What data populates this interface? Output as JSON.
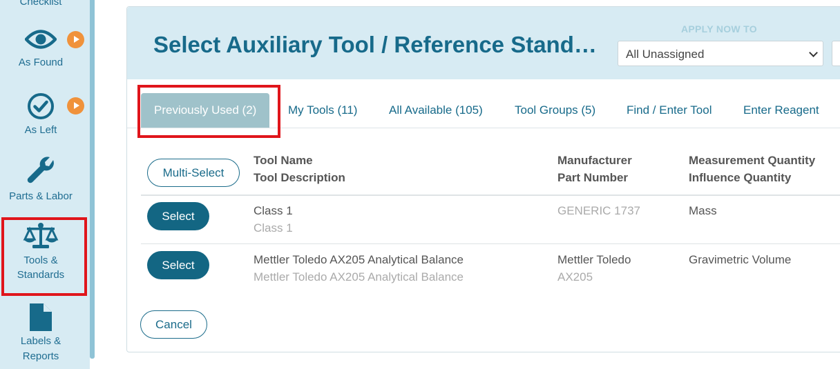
{
  "sidebar": {
    "items": [
      {
        "label": "Checklist",
        "icon": "checklist-icon"
      },
      {
        "label": "As Found",
        "icon": "eye-icon"
      },
      {
        "label": "As Left",
        "icon": "check-circle-icon"
      },
      {
        "label": "Parts & Labor",
        "icon": "wrench-icon"
      },
      {
        "label1": "Tools &",
        "label2": "Standards",
        "icon": "scale-icon"
      },
      {
        "label1": "Labels &",
        "label2": "Reports",
        "icon": "document-icon"
      }
    ]
  },
  "header": {
    "title": "Select Auxiliary Tool / Reference Stand…",
    "apply_label": "APPLY NOW TO",
    "apply_value": "All Unassigned"
  },
  "tabs": [
    {
      "label": "Previously Used (2)",
      "active": true
    },
    {
      "label": "My Tools (11)"
    },
    {
      "label": "All Available (105)"
    },
    {
      "label": "Tool Groups (5)"
    },
    {
      "label": "Find / Enter Tool"
    },
    {
      "label": "Enter Reagent"
    }
  ],
  "table": {
    "multi_select": "Multi-Select",
    "headers": {
      "col1_line1": "Tool Name",
      "col1_line2": "Tool Description",
      "col2_line1": "Manufacturer",
      "col2_line2": "Part Number",
      "col3_line1": "Measurement Quantity",
      "col3_line2": "Influence Quantity"
    },
    "rows": [
      {
        "select": "Select",
        "name": "Class 1",
        "description": "Class 1",
        "manufacturer": "GENERIC 1737",
        "part": "",
        "quantity": "Mass"
      },
      {
        "select": "Select",
        "name": "Mettler Toledo AX205 Analytical Balance",
        "description": "Mettler Toledo AX205 Analytical Balance",
        "manufacturer": "Mettler Toledo",
        "part": "AX205",
        "quantity": "Gravimetric Volume"
      }
    ]
  },
  "cancel_label": "Cancel",
  "colors": {
    "accent": "#176a8a",
    "sidebar_bg": "#d7ebf3",
    "play": "#f0923b",
    "highlight": "#e0151b",
    "active_tab": "#9fc2ca"
  }
}
